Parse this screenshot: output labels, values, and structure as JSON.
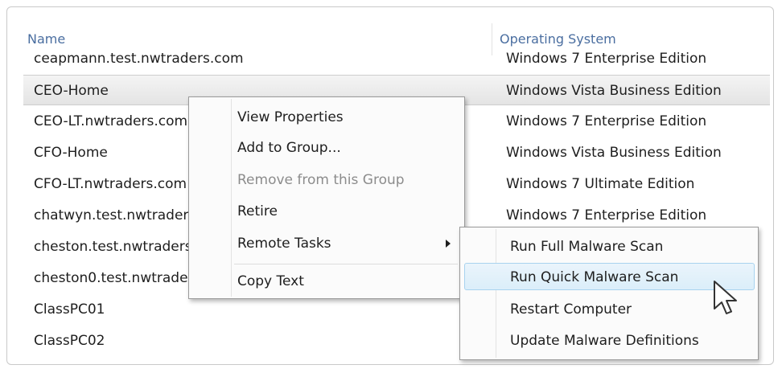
{
  "columns": {
    "name": "Name",
    "os": "Operating System"
  },
  "rows": [
    {
      "name": "ceapmann.test.nwtraders.com",
      "os": "Windows 7 Enterprise Edition"
    },
    {
      "name": "CEO-Home",
      "os": "Windows Vista Business Edition",
      "selected": true
    },
    {
      "name": "CEO-LT.nwtraders.com",
      "os": "Windows 7 Enterprise Edition"
    },
    {
      "name": "CFO-Home",
      "os": "Windows Vista Business Edition"
    },
    {
      "name": "CFO-LT.nwtraders.com",
      "os": "Windows 7 Ultimate Edition"
    },
    {
      "name": "chatwyn.test.nwtraders.com",
      "os": "Windows 7 Enterprise Edition"
    },
    {
      "name": "cheston.test.nwtraders.com",
      "os": ""
    },
    {
      "name": "cheston0.test.nwtraders.com",
      "os": ""
    },
    {
      "name": "ClassPC01",
      "os": ""
    },
    {
      "name": "ClassPC02",
      "os": ""
    }
  ],
  "context_menu": {
    "items": [
      {
        "label": "View Properties"
      },
      {
        "label": "Add to Group..."
      },
      {
        "label": "Remove from this Group",
        "disabled": true
      },
      {
        "label": "Retire"
      },
      {
        "label": "Remote Tasks",
        "has_submenu": true
      },
      {
        "label": "Copy Text"
      }
    ]
  },
  "submenu": {
    "items": [
      {
        "label": "Run Full Malware Scan"
      },
      {
        "label": "Run Quick Malware Scan",
        "hovered": true
      },
      {
        "label": "Restart Computer"
      },
      {
        "label": "Update Malware Definitions"
      }
    ]
  },
  "icons": {
    "cursor": "mouse-pointer-icon",
    "submenu_arrow": "chevron-right-icon"
  },
  "colors": {
    "header_text": "#4a6ea0",
    "hover_border": "#a8d3ef",
    "hover_fill": "#dbeefa"
  }
}
